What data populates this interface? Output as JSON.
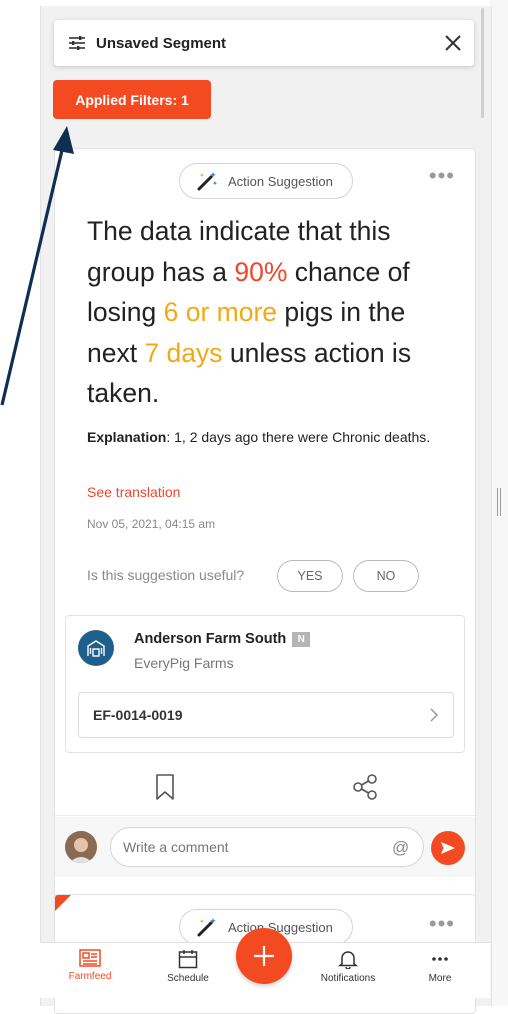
{
  "segment": {
    "title": "Unsaved Segment",
    "applied_filters": "Applied Filters: 1"
  },
  "card": {
    "badge_label": "Action Suggestion",
    "headline": {
      "p1": "The data indicate that this group has a ",
      "probability": "90%",
      "p2": " chance of losing ",
      "amount": "6 or more",
      "p3": " pigs in the next ",
      "period": "7 days",
      "p4": " unless action is taken."
    },
    "explanation_label": "Explanation",
    "explanation_text": ": 1, 2 days ago there were Chronic deaths.",
    "see_translation": "See translation",
    "timestamp": "Nov 05, 2021, 04:15 am",
    "useful_question": "Is this suggestion useful?",
    "yes_label": "YES",
    "no_label": "NO",
    "farm": {
      "name": "Anderson Farm South",
      "badge": "N",
      "company": "EveryPig Farms",
      "pen_id": "EF-0014-0019"
    },
    "comment_placeholder": "Write a comment",
    "at_symbol": "@"
  },
  "card2": {
    "badge_label": "Action Suggestion"
  },
  "nav": {
    "farmfeed": "Farmfeed",
    "schedule": "Schedule",
    "notifications": "Notifications",
    "more": "More"
  },
  "colors": {
    "accent": "#f44a22",
    "highlight_red": "#f0462a",
    "highlight_yellow": "#f3a913",
    "farm_avatar": "#1e5f8c"
  }
}
